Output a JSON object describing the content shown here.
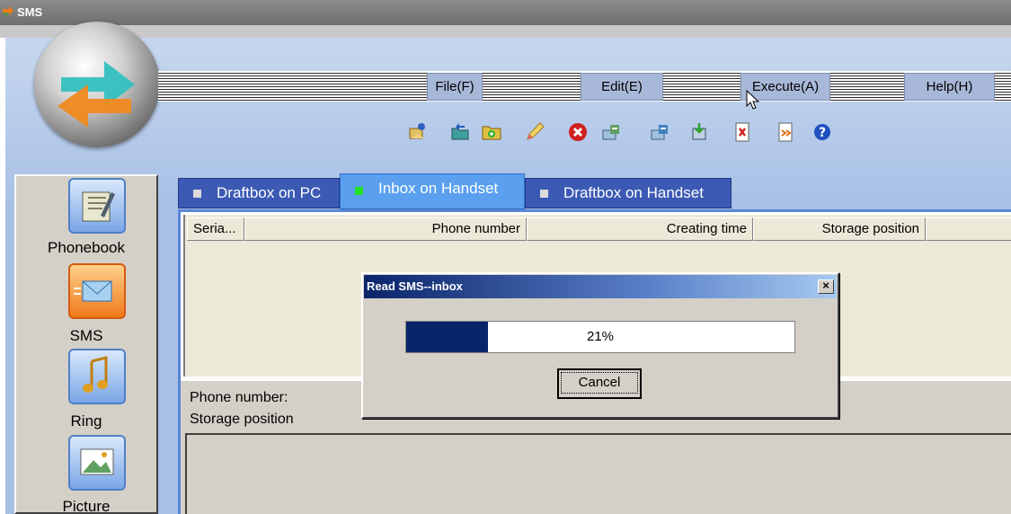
{
  "window": {
    "title": "SMS"
  },
  "menu": [
    {
      "label": "File(F)"
    },
    {
      "label": "Edit(E)"
    },
    {
      "label": "Execute(A)"
    },
    {
      "label": "Help(H)"
    }
  ],
  "toolbar": [
    {
      "icon": "new-message-icon"
    },
    {
      "icon": "open-folder-icon"
    },
    {
      "icon": "add-folder-icon"
    },
    {
      "icon": "edit-icon"
    },
    {
      "icon": "delete-icon"
    },
    {
      "icon": "send-icon"
    },
    {
      "icon": "receive-icon"
    },
    {
      "icon": "import-icon"
    },
    {
      "icon": "export-icon"
    },
    {
      "icon": "forward-icon"
    },
    {
      "icon": "help-icon"
    }
  ],
  "sidebar": {
    "items": [
      {
        "label": "Phonebook"
      },
      {
        "label": "SMS"
      },
      {
        "label": "Ring"
      },
      {
        "label": "Picture"
      }
    ]
  },
  "tabs": [
    {
      "label": "Draftbox on PC"
    },
    {
      "label": "Inbox on Handset"
    },
    {
      "label": "Draftbox on Handset"
    }
  ],
  "table": {
    "columns": [
      "Seria...",
      "Phone number",
      "Creating time",
      "Storage position"
    ]
  },
  "detail": {
    "phone_label": "Phone number:",
    "storage_label": "Storage position"
  },
  "dialog": {
    "title": "Read SMS--inbox",
    "close": "×",
    "progress": 21,
    "progress_text": "21%",
    "cancel": "Cancel"
  },
  "colors": {
    "accent": "#3c5ab4",
    "active_tab": "#5aa0ee",
    "progress_fill": "#0a246a",
    "window_bg": "#a8c0e6"
  }
}
